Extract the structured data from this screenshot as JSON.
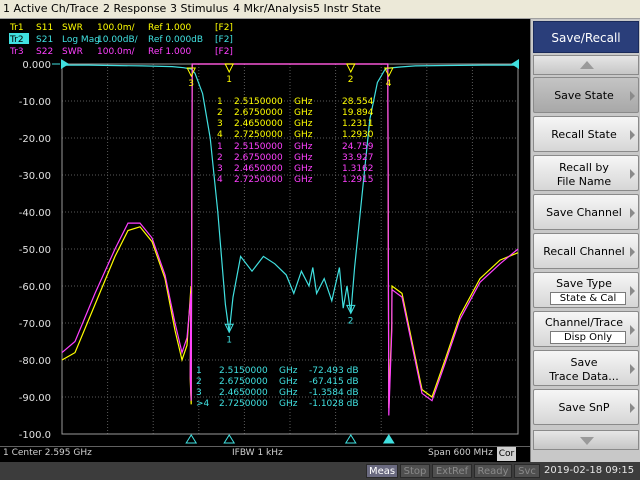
{
  "menu": [
    "1 Active Ch/Trace",
    "2 Response",
    "3 Stimulus",
    "4 Mkr/Analysis",
    "5 Instr State"
  ],
  "trace_header": [
    {
      "id": "Tr1",
      "param": "S11",
      "format": "SWR",
      "scale": "100.0m/",
      "ref": "Ref 1.000",
      "tag": "[F2]",
      "color": "#ffff00",
      "active": false
    },
    {
      "id": "Tr2",
      "param": "S21",
      "format": "Log Mag",
      "scale": "10.00dB/",
      "ref": "Ref 0.000dB",
      "tag": "[F2]",
      "color": "#40e0e0",
      "active": true
    },
    {
      "id": "Tr3",
      "param": "S22",
      "format": "SWR",
      "scale": "100.0m/",
      "ref": "Ref 1.000",
      "tag": "[F2]",
      "color": "#ff40ff",
      "active": false
    }
  ],
  "y_ticks": [
    "0.000",
    "-10.00",
    "-20.00",
    "-30.00",
    "-40.00",
    "-50.00",
    "-60.00",
    "-70.00",
    "-80.00",
    "-90.00",
    "-100.0"
  ],
  "marker_tables": {
    "tr1": [
      {
        "n": "1",
        "freq": "2.5150000",
        "unit": "GHz",
        "val": "28.554"
      },
      {
        "n": "2",
        "freq": "2.6750000",
        "unit": "GHz",
        "val": "19.894"
      },
      {
        "n": "3",
        "freq": "2.4650000",
        "unit": "GHz",
        "val": "1.2311"
      },
      {
        "n": "4",
        "freq": "2.7250000",
        "unit": "GHz",
        "val": "1.2930"
      }
    ],
    "tr3": [
      {
        "n": "1",
        "freq": "2.5150000",
        "unit": "GHz",
        "val": "24.759"
      },
      {
        "n": "2",
        "freq": "2.6750000",
        "unit": "GHz",
        "val": "33.927"
      },
      {
        "n": "3",
        "freq": "2.4650000",
        "unit": "GHz",
        "val": "1.3162"
      },
      {
        "n": "4",
        "freq": "2.7250000",
        "unit": "GHz",
        "val": "1.2915"
      }
    ],
    "tr2": [
      {
        "n": "1",
        "freq": "2.5150000",
        "unit": "GHz",
        "val": "-72.493 dB"
      },
      {
        "n": "2",
        "freq": "2.6750000",
        "unit": "GHz",
        "val": "-67.415 dB"
      },
      {
        "n": "3",
        "freq": "2.4650000",
        "unit": "GHz",
        "val": "-1.3584 dB"
      },
      {
        "n": ">4",
        "freq": "2.7250000",
        "unit": "GHz",
        "val": "-1.1028 dB"
      }
    ]
  },
  "status": {
    "center": "1  Center 2.595 GHz",
    "ifbw": "IFBW 1 kHz",
    "span": "Span 600 MHz",
    "cor": "Cor"
  },
  "bottom": {
    "items": [
      "Meas",
      "Stop",
      "ExtRef",
      "Ready",
      "Svc"
    ],
    "active": "Meas",
    "datetime": "2019-02-18 09:15"
  },
  "softkeys": {
    "title": "Save/Recall",
    "buttons": [
      {
        "label": "Save State",
        "sub": "",
        "hl": true
      },
      {
        "label": "Recall State",
        "sub": "",
        "hl": false
      },
      {
        "label": "Recall by|File Name",
        "sub": "",
        "hl": false
      },
      {
        "label": "Save Channel",
        "sub": "",
        "hl": false
      },
      {
        "label": "Recall Channel",
        "sub": "",
        "hl": false
      },
      {
        "label": "Save Type",
        "sub": "State & Cal",
        "hl": false
      },
      {
        "label": "Channel/Trace",
        "sub": "Disp Only",
        "hl": false
      },
      {
        "label": "Save|Trace Data...",
        "sub": "",
        "hl": false
      },
      {
        "label": "Save SnP",
        "sub": "",
        "hl": false
      }
    ]
  },
  "chart_data": {
    "type": "line",
    "x_range_ghz": [
      2.295,
      2.895
    ],
    "y_ticks": [
      "0.000",
      "-10.00",
      "-20.00",
      "-30.00",
      "-40.00",
      "-50.00",
      "-60.00",
      "-70.00",
      "-80.00",
      "-90.00",
      "-100.0"
    ],
    "ylim_db": [
      -100,
      0
    ],
    "grid": true,
    "markers": [
      {
        "n": "1",
        "freq_ghz": 2.515
      },
      {
        "n": "2",
        "freq_ghz": 2.675
      },
      {
        "n": "3",
        "freq_ghz": 2.465
      },
      {
        "n": "4",
        "freq_ghz": 2.725
      }
    ],
    "series": [
      {
        "name": "S21",
        "color": "#40e0e0",
        "x": [
          2.295,
          2.33,
          2.36,
          2.4,
          2.44,
          2.455,
          2.46,
          2.465,
          2.47,
          2.48,
          2.49,
          2.5,
          2.51,
          2.515,
          2.52,
          2.53,
          2.545,
          2.56,
          2.575,
          2.59,
          2.6,
          2.61,
          2.62,
          2.625,
          2.63,
          2.64,
          2.65,
          2.66,
          2.665,
          2.67,
          2.675,
          2.68,
          2.69,
          2.7,
          2.71,
          2.72,
          2.725,
          2.74,
          2.76,
          2.8,
          2.85,
          2.895
        ],
        "y": [
          -0.3,
          -0.3,
          -0.4,
          -0.5,
          -0.7,
          -1.0,
          -1.2,
          -1.36,
          -2.5,
          -8,
          -20,
          -40,
          -65,
          -72.5,
          -63,
          -52,
          -56,
          -52,
          -54,
          -57,
          -62,
          -56,
          -60,
          -55,
          -62,
          -58,
          -64,
          -55,
          -66,
          -60,
          -67.4,
          -55,
          -35,
          -15,
          -5,
          -1.5,
          -1.1,
          -0.8,
          -0.5,
          -0.4,
          -0.3,
          -0.3
        ]
      }
    ]
  }
}
